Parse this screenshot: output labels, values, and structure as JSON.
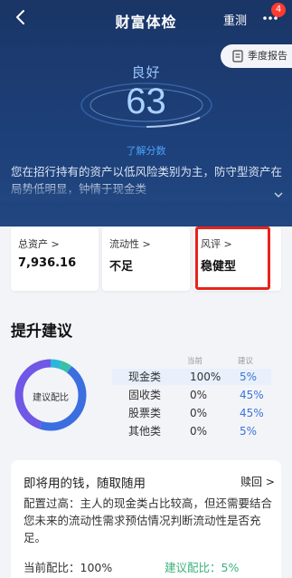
{
  "header": {
    "title": "财富体检",
    "reset_label": "重测",
    "notification_count": "4",
    "report_label": "季度报告"
  },
  "score": {
    "rating": "良好",
    "value": "63",
    "learn_more": "了解分数"
  },
  "summary": "您在招行持有的资产以低风险类别为主，防守型资产在局势低明显，钟情于现金类",
  "cards": [
    {
      "label": "总资产 >",
      "value": "7,936.16"
    },
    {
      "label": "流动性 >",
      "value": "不足"
    },
    {
      "label": "风评 >",
      "value": "稳健型"
    }
  ],
  "section_title": "提升建议",
  "allocation": {
    "center_label": "建议配比",
    "current_header": "当前",
    "suggest_header": "建议",
    "rows": [
      {
        "name": "现金类",
        "current": "100%",
        "suggest": "5%"
      },
      {
        "name": "固收类",
        "current": "0%",
        "suggest": "45%"
      },
      {
        "name": "股票类",
        "current": "0%",
        "suggest": "45%"
      },
      {
        "name": "其他类",
        "current": "0%",
        "suggest": "5%"
      }
    ],
    "colors": {
      "cash": "#2bb8d8",
      "fixed_income": "#3b6fe0",
      "stock": "#7057e6",
      "other": "#38c0a8"
    }
  },
  "advice": {
    "title": "即将用的钱，随取随用",
    "link": "赎回 >",
    "text": "配置过高：主人的现金类占比较高，但还需要结合您未来的流动性需求预估情况判断流动性是否充足。",
    "current": "当前配比：100%",
    "suggest": "建议配比：5%"
  },
  "colors": {
    "hero": "#1d3f78",
    "accent": "#3a74d8",
    "highlight_border": "#e8231c"
  }
}
